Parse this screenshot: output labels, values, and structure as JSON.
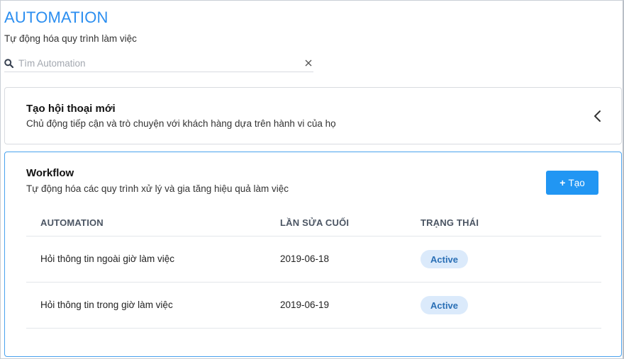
{
  "header": {
    "title": "AUTOMATION",
    "subtitle": "Tự động hóa quy trình làm việc"
  },
  "search": {
    "placeholder": "Tìm Automation",
    "value": ""
  },
  "new_conversation": {
    "title": "Tạo hội thoại mới",
    "description": "Chủ động tiếp cận và trò chuyện với khách hàng dựa trên hành vi của họ",
    "icon": "chevron-left-icon"
  },
  "workflow": {
    "title": "Workflow",
    "description": "Tự động hóa các quy trình xử lý và gia tăng hiệu quả làm việc",
    "create_label": "Tạo",
    "table": {
      "columns": [
        "AUTOMATION",
        "LẦN SỬA CUỐI",
        "TRẠNG THÁI"
      ],
      "rows": [
        {
          "name": "Hỏi thông tin ngoài giờ làm việc",
          "last_edited": "2019-06-18",
          "status": "Active"
        },
        {
          "name": "Hỏi thông tin trong giờ làm việc",
          "last_edited": "2019-06-19",
          "status": "Active"
        }
      ]
    }
  },
  "colors": {
    "accent": "#2196f3",
    "title": "#2b8ef0",
    "badge_bg": "#dbeafb",
    "badge_text": "#2a6fb5"
  }
}
